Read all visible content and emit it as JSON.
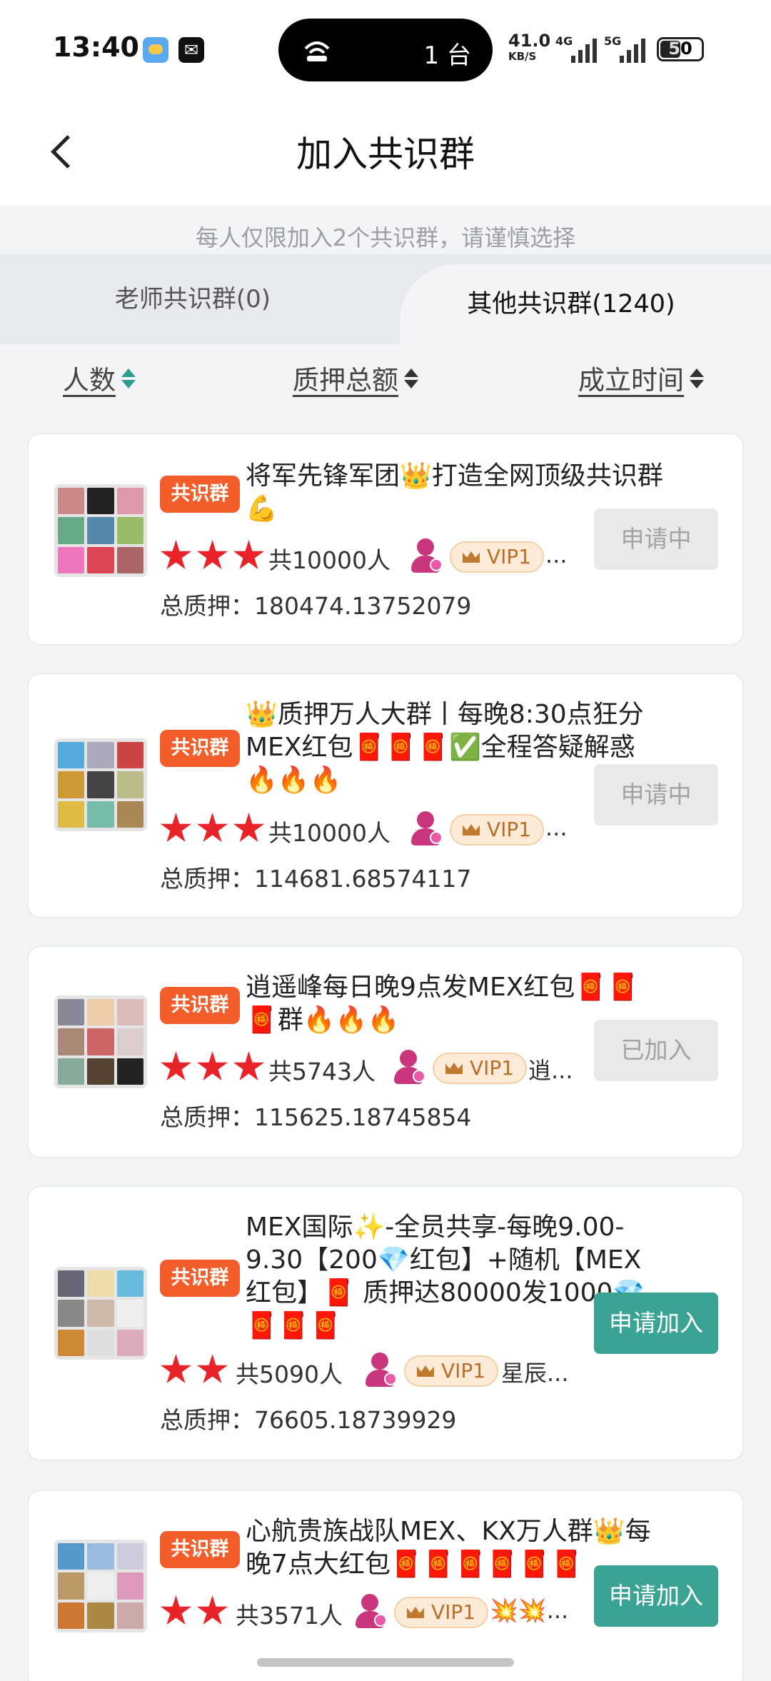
{
  "status": {
    "time": "13:40",
    "pill_count": "1 台",
    "speed_value": "41.0",
    "speed_unit": "KB/S",
    "net1": "4G",
    "net2": "5G",
    "battery": "50"
  },
  "header": {
    "title": "加入共识群"
  },
  "notice": "每人仅限加入2个共识群，请谨慎选择",
  "tabs": {
    "left": "老师共识群(0)",
    "right": "其他共识群(1240)"
  },
  "sort": {
    "people": "人数",
    "amount": "质押总额",
    "time": "成立时间"
  },
  "groups": [
    {
      "tag": "共识群",
      "name": "将军先锋军团👑打造全网顶级共识群💪",
      "stars": 3,
      "count": "共10000人",
      "vip": "VIP1",
      "owner": "...",
      "pledge": "总质押：180474.13752079",
      "button": "申请中"
    },
    {
      "tag": "共识群",
      "name": "👑质押万人大群丨每晚8:30点狂分MEX红包🧧🧧🧧✅全程答疑解惑🔥🔥🔥",
      "stars": 3,
      "count": "共10000人",
      "vip": "VIP1",
      "owner": "...",
      "pledge": "总质押：114681.68574117",
      "button": "申请中"
    },
    {
      "tag": "共识群",
      "name": "逍遥峰每日晚9点发MEX红包🧧🧧🧧群🔥🔥🔥",
      "stars": 3,
      "count": "共5743人",
      "vip": "VIP1",
      "owner": "逍...",
      "pledge": "总质押：115625.18745854",
      "button": "已加入"
    },
    {
      "tag": "共识群",
      "name": "MEX国际✨-全员共享-每晚9.00-9.30【200💎红包】+随机【MEX红包】🧧 质押达80000发1000💎🧧🧧🧧",
      "stars": 2,
      "count": "共5090人",
      "vip": "VIP1",
      "owner": "星辰...",
      "pledge": "总质押：76605.18739929",
      "button": "申请加入"
    },
    {
      "tag": "共识群",
      "name": "心航贵族战队MEX、KX万人群👑每晚7点大红包🧧🧧🧧🧧🧧🧧",
      "stars": 2,
      "count": "共3571人",
      "vip": "VIP1",
      "owner": "💥💥...",
      "pledge": "",
      "button": "申请加入"
    }
  ]
}
